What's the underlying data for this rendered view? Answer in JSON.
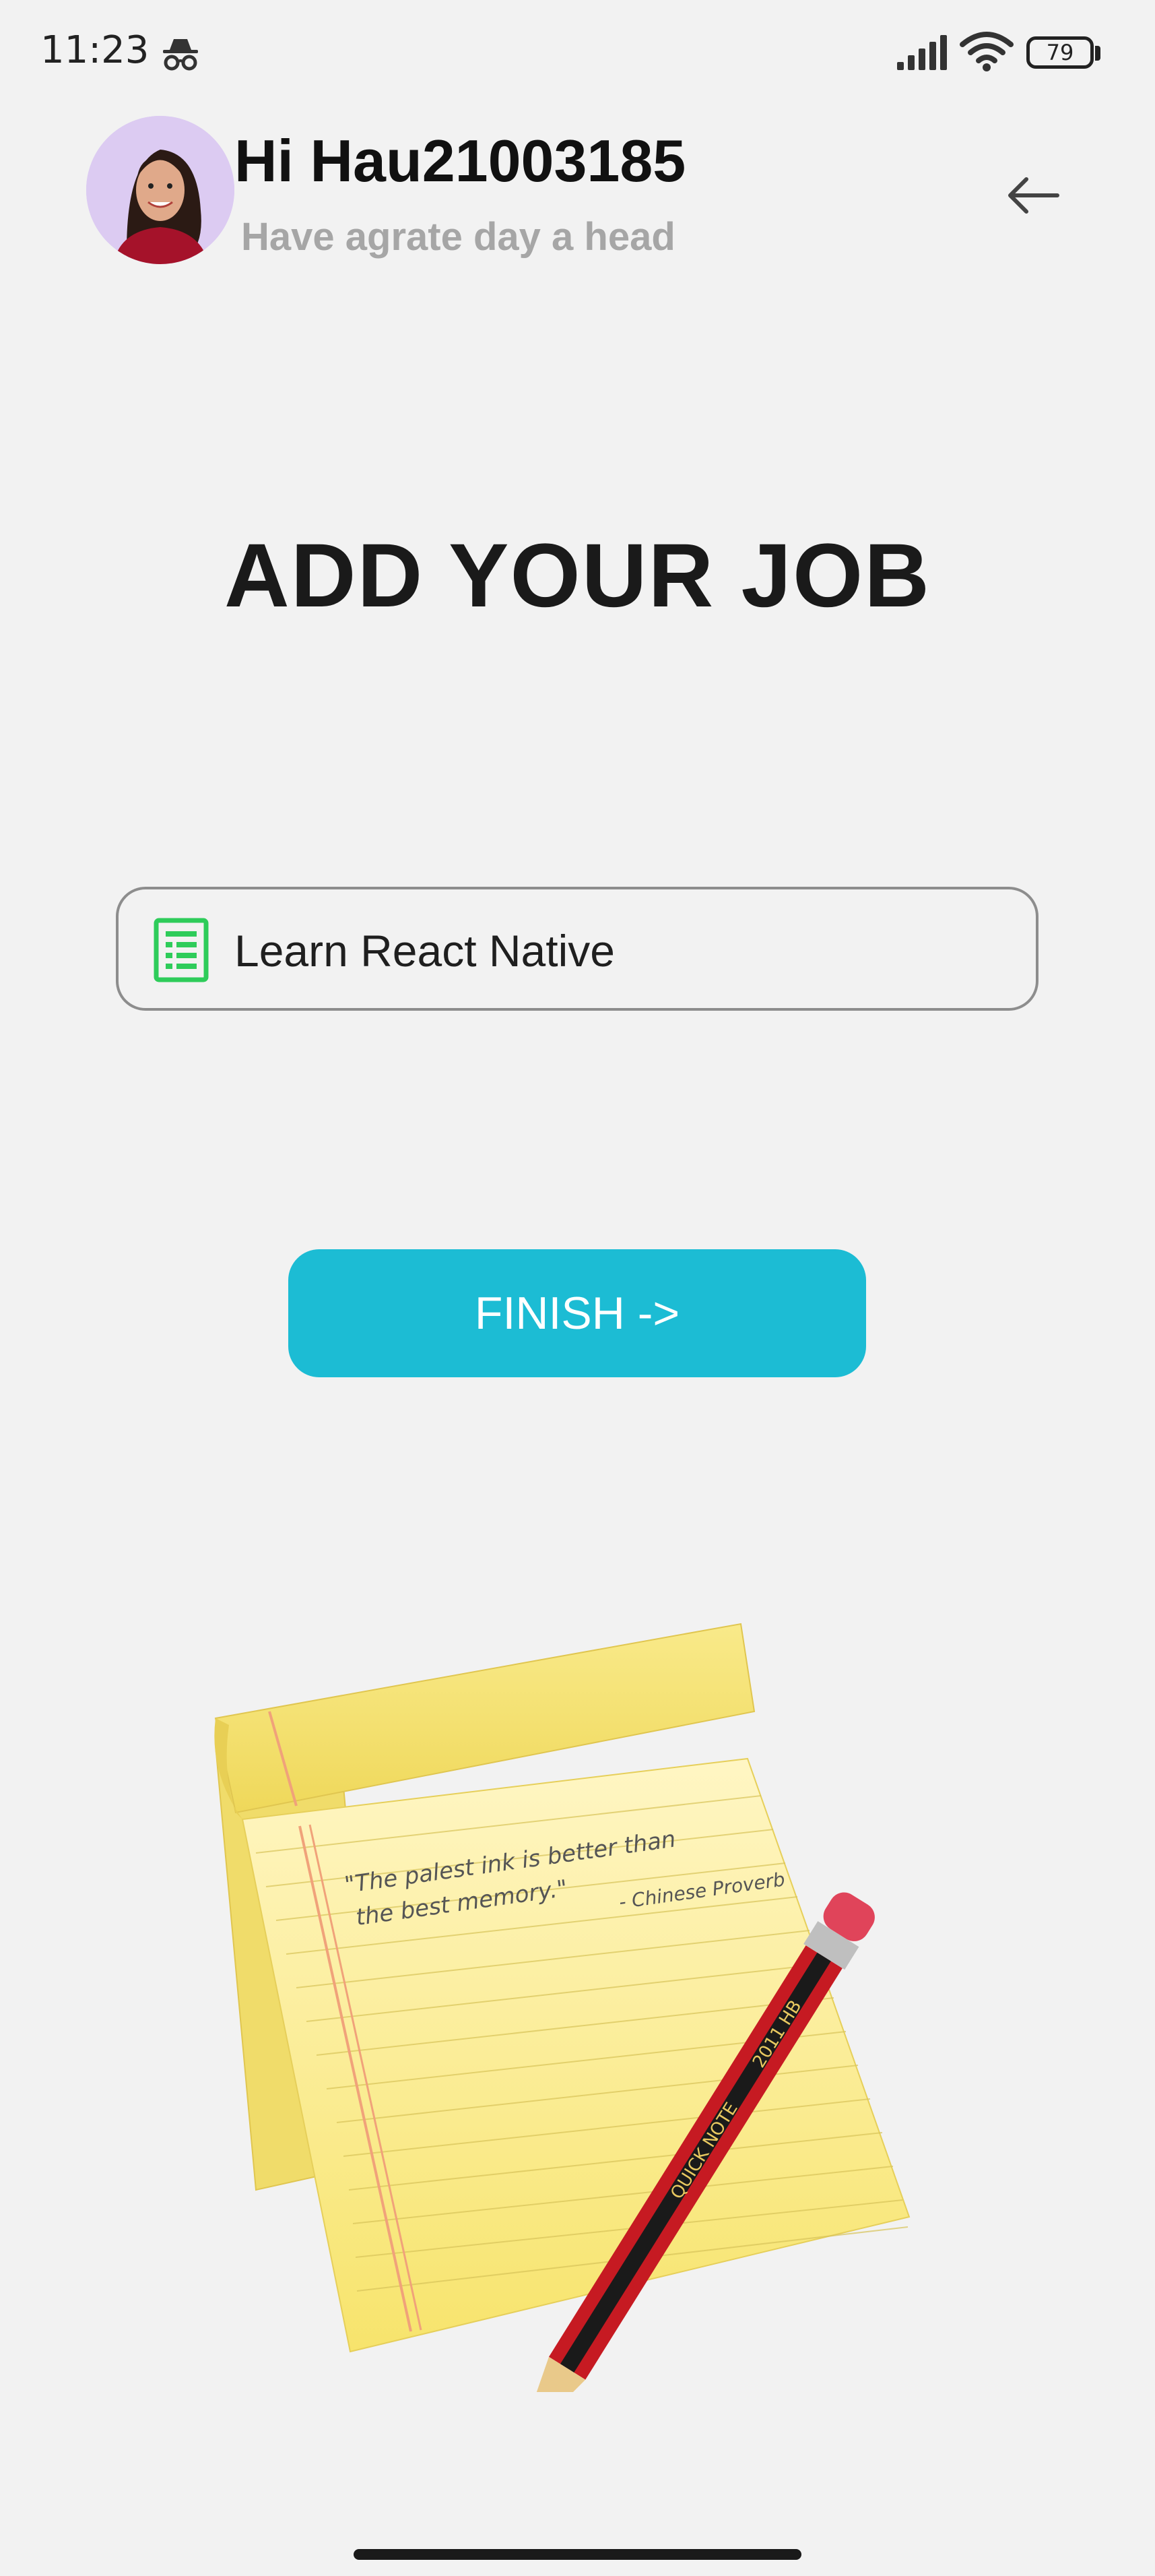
{
  "status_bar": {
    "time": "11:23",
    "battery": "79",
    "icons": [
      "incognito-icon",
      "signal-icon",
      "wifi-icon",
      "battery-icon"
    ]
  },
  "header": {
    "greeting": "Hi Hau21003185",
    "subtitle": "Have agrate day a head",
    "back_icon": "arrow-left-icon"
  },
  "page": {
    "title": "ADD YOUR JOB"
  },
  "job_input": {
    "value": "Learn React Native",
    "icon": "spreadsheet-icon"
  },
  "finish_button": {
    "label": "FINISH ->"
  },
  "illustration": {
    "note_quote_line1": "\"The palest ink is better than",
    "note_quote_line2": "the best memory.\"",
    "note_attribution": "- Chinese Proverb",
    "pencil_text1": "QUICK NOTE",
    "pencil_text2": "2011 HB"
  },
  "colors": {
    "accent": "#1cbcd4",
    "sheet_icon": "#2ecc5a",
    "background": "#f2f2f2",
    "subtitle": "#a6a6a6"
  }
}
